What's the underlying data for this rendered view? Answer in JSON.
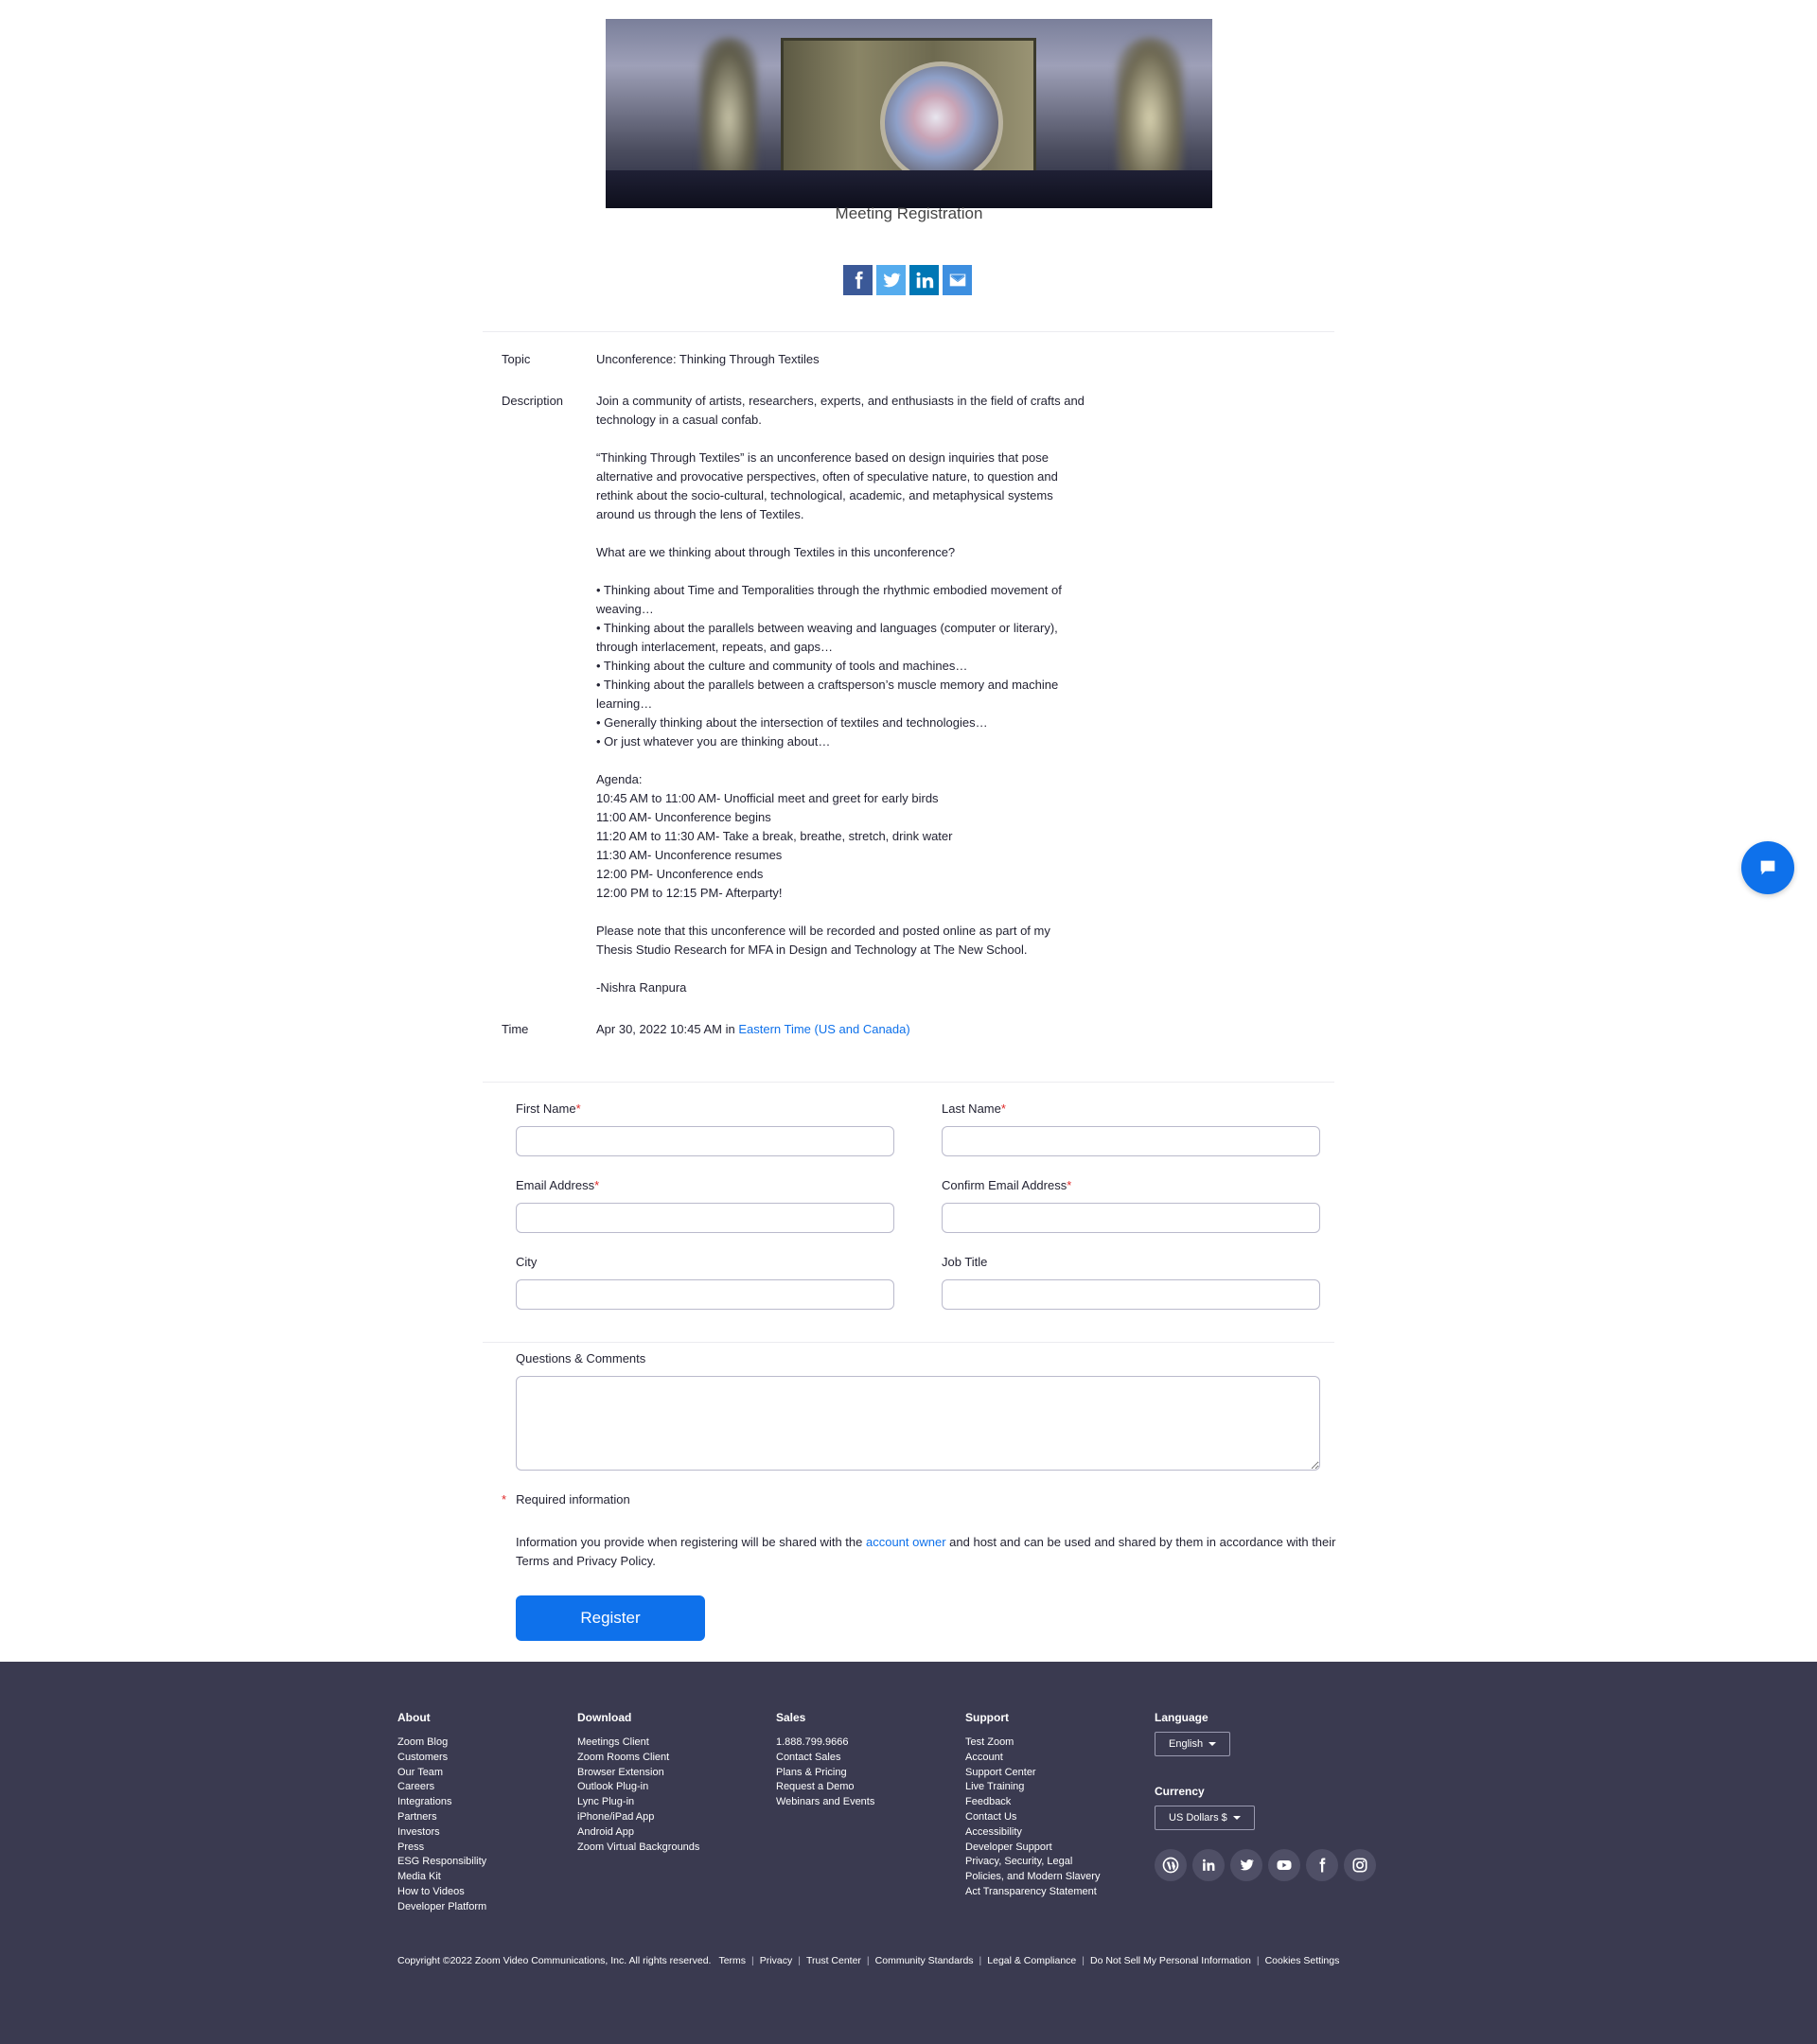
{
  "header": {
    "page_title": "Meeting Registration"
  },
  "share": {
    "icons": [
      "facebook-icon",
      "twitter-icon",
      "linkedin-icon",
      "email-icon"
    ],
    "colors": {
      "facebook": "#3b5998",
      "twitter": "#55acee",
      "linkedin": "#0077b5",
      "email": "#3d8fe0"
    }
  },
  "meeting": {
    "topic_label": "Topic",
    "topic": "Unconference: Thinking Through Textiles",
    "description_label": "Description",
    "description_lines": [
      "Join a community of artists, researchers, experts, and enthusiasts in the field of crafts and",
      "technology in a casual confab.",
      "",
      "“Thinking Through Textiles” is an unconference based on design inquiries that pose",
      "alternative and provocative perspectives, often of speculative nature, to question and",
      "rethink about the socio-cultural, technological, academic, and metaphysical systems",
      "around us through the lens of Textiles.",
      "",
      "What are we thinking about through Textiles in this unconference?",
      "",
      "• Thinking about Time and Temporalities through the rhythmic embodied movement of",
      "weaving…",
      "• Thinking about the parallels between weaving and languages (computer or literary),",
      "through interlacement, repeats, and gaps…",
      "• Thinking about the culture and community of tools and machines…",
      "• Thinking about the parallels between a craftsperson’s muscle memory and machine",
      "learning…",
      "• Generally thinking about the intersection of textiles and technologies…",
      "• Or just whatever you are thinking about…",
      "",
      "Agenda:",
      "10:45 AM to 11:00 AM- Unofficial meet and greet for early birds",
      "11:00 AM- Unconference begins",
      "11:20 AM to 11:30 AM- Take a break, breathe, stretch, drink water",
      "11:30 AM- Unconference resumes",
      "12:00 PM- Unconference ends",
      "12:00 PM to 12:15 PM- Afterparty!",
      "",
      "Please note that this unconference will be recorded and posted online as part of my",
      "Thesis Studio Research for MFA in Design and Technology at The New School.",
      "",
      "-Nishra Ranpura"
    ],
    "time_label": "Time",
    "time_value": "Apr 30, 2022 10:45 AM in ",
    "timezone_link": "Eastern Time (US and Canada)"
  },
  "form": {
    "first_name_label": "First Name",
    "last_name_label": "Last Name",
    "email_label": "Email Address",
    "confirm_email_label": "Confirm Email Address",
    "city_label": "City",
    "job_title_label": "Job Title",
    "comments_label": "Questions & Comments",
    "required_marker": "*",
    "first_name_value": "",
    "last_name_value": "",
    "email_value": "",
    "confirm_email_value": "",
    "city_value": "",
    "job_title_value": "",
    "comments_value": "",
    "required_note": "Required information",
    "privacy_before": "Information you provide when registering will be shared with the ",
    "privacy_link": "account owner",
    "privacy_after": " and host and can be used and shared by them in accordance with their Terms and Privacy Policy.",
    "register_label": "Register"
  },
  "footer": {
    "about": {
      "title": "About",
      "items": [
        "Zoom Blog",
        "Customers",
        "Our Team",
        "Careers",
        "Integrations",
        "Partners",
        "Investors",
        "Press",
        "ESG Responsibility",
        "Media Kit",
        "How to Videos",
        "Developer Platform"
      ]
    },
    "download": {
      "title": "Download",
      "items": [
        "Meetings Client",
        "Zoom Rooms Client",
        "Browser Extension",
        "Outlook Plug-in",
        "Lync Plug-in",
        "iPhone/iPad App",
        "Android App",
        "Zoom Virtual Backgrounds"
      ]
    },
    "sales": {
      "title": "Sales",
      "items": [
        "1.888.799.9666",
        "Contact Sales",
        "Plans & Pricing",
        "Request a Demo",
        "Webinars and Events"
      ]
    },
    "support": {
      "title": "Support",
      "items": [
        "Test Zoom",
        "Account",
        "Support Center",
        "Live Training",
        "Feedback",
        "Contact Us",
        "Accessibility",
        "Developer Support",
        "Privacy, Security, Legal",
        "Policies, and Modern Slavery",
        "Act Transparency Statement"
      ]
    },
    "language": {
      "title": "Language",
      "selected": "English"
    },
    "currency": {
      "title": "Currency",
      "selected": "US Dollars $"
    },
    "social_icons": [
      "wordpress-icon",
      "linkedin-icon",
      "twitter-icon",
      "youtube-icon",
      "facebook-icon",
      "instagram-icon"
    ],
    "copyright": "Copyright ©2022 Zoom Video Communications, Inc. All rights reserved.",
    "legal_links": [
      "Terms",
      "Privacy",
      "Trust Center",
      "Community Standards",
      "Legal & Compliance",
      "Do Not Sell My Personal Information",
      "Cookies Settings"
    ],
    "background": "#3a3a50"
  },
  "colors": {
    "accent": "#0e71eb",
    "required": "#e02828"
  }
}
